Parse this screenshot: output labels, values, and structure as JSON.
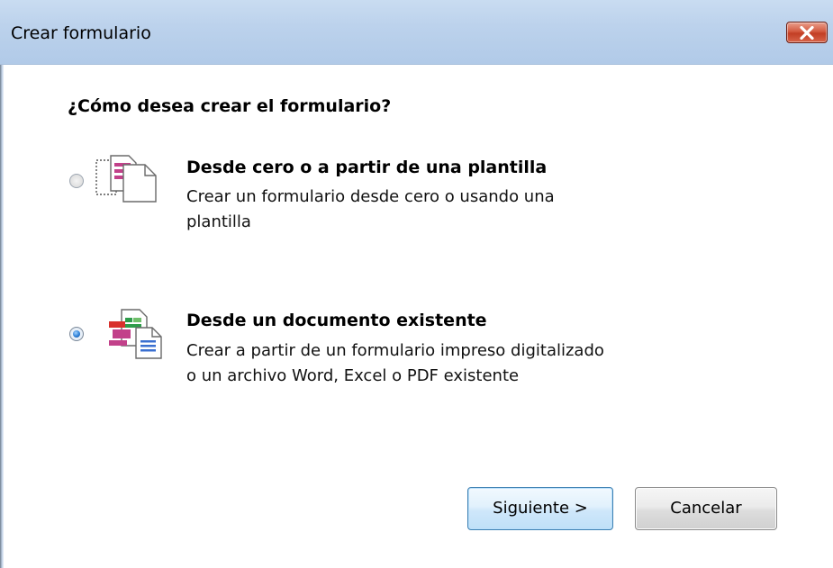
{
  "window": {
    "title": "Crear formulario",
    "close_icon": "close-icon"
  },
  "main": {
    "question": "¿Cómo desea crear el formulario?",
    "options": [
      {
        "title": "Desde cero o a partir de una plantilla",
        "desc_line1": "Crear un formulario desde cero o usando una",
        "desc_line2": "plantilla",
        "selected": false,
        "icon": "blank-form-template-icon"
      },
      {
        "title": "Desde un documento existente",
        "desc_line1": "Crear a partir de un formulario impreso digitalizado",
        "desc_line2": "o un archivo Word, Excel o PDF existente",
        "selected": true,
        "icon": "existing-document-icon"
      }
    ]
  },
  "buttons": {
    "next_label": "Siguiente >",
    "cancel_label": "Cancelar"
  },
  "colors": {
    "titlebar": "#bcd2ec",
    "close_button": "#c94a30",
    "primary_button_border": "#3c7fb1"
  }
}
